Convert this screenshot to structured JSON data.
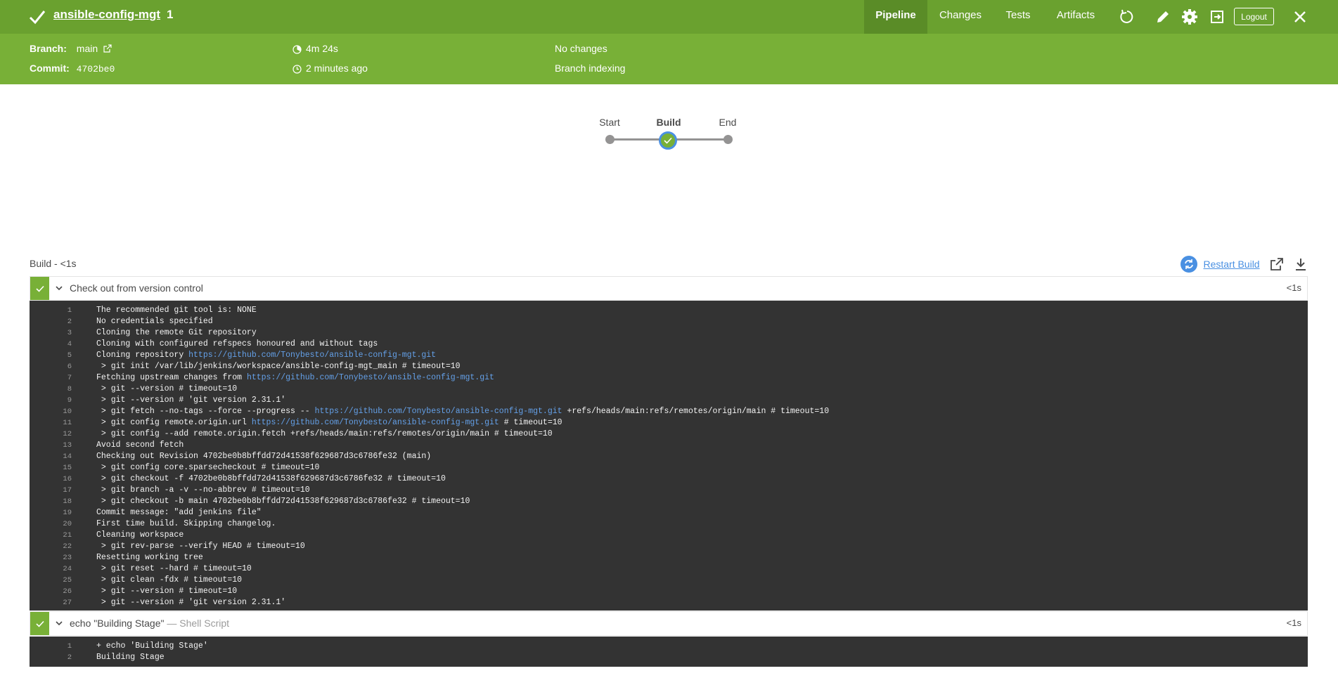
{
  "header": {
    "job_name": "ansible-config-mgt",
    "run_number": "1",
    "tabs": [
      "Pipeline",
      "Changes",
      "Tests",
      "Artifacts"
    ],
    "active_tab": "Pipeline",
    "logout_label": "Logout",
    "icons": [
      "replay-icon",
      "edit-icon",
      "settings-icon",
      "exit-icon",
      "close-icon"
    ]
  },
  "summary": {
    "branch_label": "Branch:",
    "branch_value": "main",
    "commit_label": "Commit:",
    "commit_value": "4702be0",
    "duration": "4m 24s",
    "started": "2 minutes ago",
    "changes": "No changes",
    "cause": "Branch indexing"
  },
  "graph": {
    "stages": [
      "Start",
      "Build",
      "End"
    ],
    "selected": "Build",
    "build_status": "success"
  },
  "step_panel": {
    "title": "Build - <1s",
    "restart_label": "Restart Build"
  },
  "steps": [
    {
      "name": "Check out from version control",
      "subtitle": "",
      "duration": "<1s",
      "status": "success",
      "log": [
        "The recommended git tool is: NONE",
        "No credentials specified",
        "Cloning the remote Git repository",
        "Cloning with configured refspecs honoured and without tags",
        "Cloning repository |https://github.com/Tonybesto/ansible-config-mgt.git|",
        " > git init /var/lib/jenkins/workspace/ansible-config-mgt_main # timeout=10",
        "Fetching upstream changes from |https://github.com/Tonybesto/ansible-config-mgt.git|",
        " > git --version # timeout=10",
        " > git --version # 'git version 2.31.1'",
        " > git fetch --no-tags --force --progress -- |https://github.com/Tonybesto/ansible-config-mgt.git| +refs/heads/main:refs/remotes/origin/main # timeout=10",
        " > git config remote.origin.url |https://github.com/Tonybesto/ansible-config-mgt.git| # timeout=10",
        " > git config --add remote.origin.fetch +refs/heads/main:refs/remotes/origin/main # timeout=10",
        "Avoid second fetch",
        "Checking out Revision 4702be0b8bffdd72d41538f629687d3c6786fe32 (main)",
        " > git config core.sparsecheckout # timeout=10",
        " > git checkout -f 4702be0b8bffdd72d41538f629687d3c6786fe32 # timeout=10",
        " > git branch -a -v --no-abbrev # timeout=10",
        " > git checkout -b main 4702be0b8bffdd72d41538f629687d3c6786fe32 # timeout=10",
        "Commit message: \"add jenkins file\"",
        "First time build. Skipping changelog.",
        "Cleaning workspace",
        " > git rev-parse --verify HEAD # timeout=10",
        "Resetting working tree",
        " > git reset --hard # timeout=10",
        " > git clean -fdx # timeout=10",
        " > git --version # timeout=10",
        " > git --version # 'git version 2.31.1'"
      ]
    },
    {
      "name": "echo \"Building Stage\"",
      "subtitle": "— Shell Script",
      "duration": "<1s",
      "status": "success",
      "log": [
        "+ echo 'Building Stage'",
        "Building Stage"
      ]
    }
  ],
  "colors": {
    "header_green": "#6aa12f",
    "summary_green": "#78b037",
    "log_bg": "#333333",
    "link_blue": "#4a90e2"
  }
}
